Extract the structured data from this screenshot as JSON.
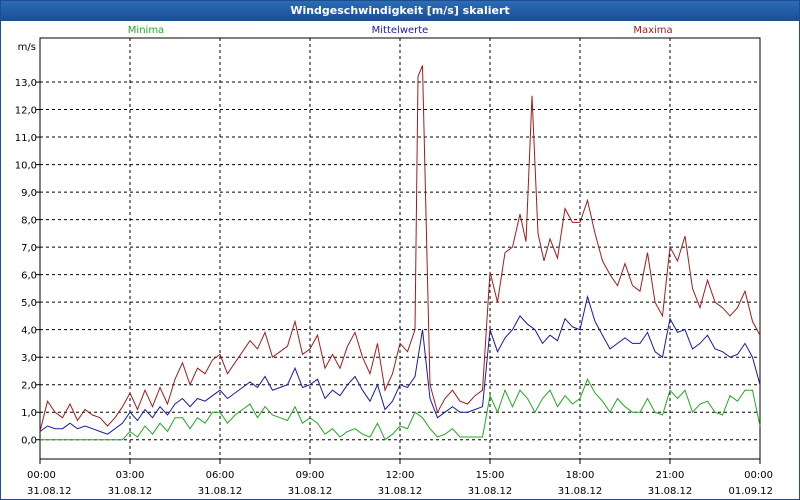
{
  "window": {
    "title": "Windgeschwindigkeit [m/s] skaliert"
  },
  "colors": {
    "titlebar": "#1f5aa6",
    "minima": "#22aa22",
    "mittel": "#1a1aa0",
    "maxima": "#a01c1c"
  },
  "legend": {
    "minima": "Minima",
    "mittel": "Mittelwerte",
    "maxima": "Maxima"
  },
  "chart_data": {
    "type": "line",
    "title": "Windgeschwindigkeit [m/s] skaliert",
    "ylabel": "m/s",
    "xlabel": "",
    "ylim": [
      -0.7,
      14.6
    ],
    "xlim_hours": [
      0,
      24
    ],
    "grid": true,
    "legend_placement": "top",
    "yticks": [
      "0,0",
      "1,0",
      "2,0",
      "3,0",
      "4,0",
      "5,0",
      "6,0",
      "7,0",
      "8,0",
      "9,0",
      "10,0",
      "11,0",
      "12,0",
      "13,0"
    ],
    "xticks": [
      {
        "time": "00:00",
        "date": "31.08.12"
      },
      {
        "time": "03:00",
        "date": "31.08.12"
      },
      {
        "time": "06:00",
        "date": "31.08.12"
      },
      {
        "time": "09:00",
        "date": "31.08.12"
      },
      {
        "time": "12:00",
        "date": "31.08.12"
      },
      {
        "time": "15:00",
        "date": "31.08.12"
      },
      {
        "time": "18:00",
        "date": "31.08.12"
      },
      {
        "time": "21:00",
        "date": "31.08.12"
      },
      {
        "time": "00:00",
        "date": "01.09.12"
      }
    ],
    "series": [
      {
        "name": "Maxima",
        "color": "#a01c1c",
        "points": [
          [
            0,
            0.3
          ],
          [
            0.25,
            1.4
          ],
          [
            0.5,
            1.0
          ],
          [
            0.75,
            0.8
          ],
          [
            1,
            1.3
          ],
          [
            1.25,
            0.7
          ],
          [
            1.5,
            1.1
          ],
          [
            1.75,
            0.9
          ],
          [
            2,
            0.8
          ],
          [
            2.25,
            0.5
          ],
          [
            2.5,
            0.8
          ],
          [
            2.75,
            1.2
          ],
          [
            3,
            1.7
          ],
          [
            3.25,
            1.1
          ],
          [
            3.5,
            1.8
          ],
          [
            3.75,
            1.2
          ],
          [
            4,
            1.9
          ],
          [
            4.25,
            1.3
          ],
          [
            4.5,
            2.2
          ],
          [
            4.75,
            2.8
          ],
          [
            5,
            2.0
          ],
          [
            5.25,
            2.6
          ],
          [
            5.5,
            2.4
          ],
          [
            5.75,
            2.9
          ],
          [
            6,
            3.1
          ],
          [
            6.25,
            2.4
          ],
          [
            6.5,
            2.8
          ],
          [
            6.75,
            3.2
          ],
          [
            7,
            3.6
          ],
          [
            7.25,
            3.3
          ],
          [
            7.5,
            3.9
          ],
          [
            7.75,
            3.0
          ],
          [
            8,
            3.2
          ],
          [
            8.25,
            3.4
          ],
          [
            8.5,
            4.3
          ],
          [
            8.75,
            3.1
          ],
          [
            9,
            3.3
          ],
          [
            9.25,
            3.8
          ],
          [
            9.5,
            2.6
          ],
          [
            9.75,
            3.1
          ],
          [
            10,
            2.6
          ],
          [
            10.25,
            3.4
          ],
          [
            10.5,
            3.9
          ],
          [
            10.75,
            3.0
          ],
          [
            11,
            2.4
          ],
          [
            11.25,
            3.5
          ],
          [
            11.5,
            1.8
          ],
          [
            11.75,
            2.4
          ],
          [
            12,
            3.5
          ],
          [
            12.25,
            3.2
          ],
          [
            12.5,
            4.0
          ],
          [
            12.6,
            13.2
          ],
          [
            12.75,
            13.6
          ],
          [
            13,
            2.0
          ],
          [
            13.25,
            1.0
          ],
          [
            13.5,
            1.5
          ],
          [
            13.75,
            1.8
          ],
          [
            14,
            1.4
          ],
          [
            14.25,
            1.3
          ],
          [
            14.5,
            1.6
          ],
          [
            14.75,
            1.8
          ],
          [
            15,
            6.1
          ],
          [
            15.25,
            5.0
          ],
          [
            15.5,
            6.8
          ],
          [
            15.75,
            7.0
          ],
          [
            16,
            8.2
          ],
          [
            16.2,
            7.2
          ],
          [
            16.4,
            12.5
          ],
          [
            16.6,
            7.5
          ],
          [
            16.8,
            6.5
          ],
          [
            17,
            7.3
          ],
          [
            17.25,
            6.6
          ],
          [
            17.5,
            8.4
          ],
          [
            17.75,
            7.9
          ],
          [
            18,
            7.9
          ],
          [
            18.25,
            8.7
          ],
          [
            18.5,
            7.5
          ],
          [
            18.75,
            6.5
          ],
          [
            19,
            6.0
          ],
          [
            19.25,
            5.6
          ],
          [
            19.5,
            6.4
          ],
          [
            19.75,
            5.6
          ],
          [
            20,
            5.4
          ],
          [
            20.25,
            6.8
          ],
          [
            20.5,
            5.0
          ],
          [
            20.75,
            4.5
          ],
          [
            21,
            7.0
          ],
          [
            21.25,
            6.5
          ],
          [
            21.5,
            7.4
          ],
          [
            21.75,
            5.5
          ],
          [
            22,
            4.8
          ],
          [
            22.25,
            5.8
          ],
          [
            22.5,
            5.0
          ],
          [
            22.75,
            4.8
          ],
          [
            23,
            4.5
          ],
          [
            23.25,
            4.8
          ],
          [
            23.5,
            5.4
          ],
          [
            23.75,
            4.3
          ],
          [
            24,
            3.8
          ]
        ]
      },
      {
        "name": "Mittelwerte",
        "color": "#1a1aa0",
        "points": [
          [
            0,
            0.3
          ],
          [
            0.25,
            0.5
          ],
          [
            0.5,
            0.4
          ],
          [
            0.75,
            0.4
          ],
          [
            1,
            0.6
          ],
          [
            1.25,
            0.4
          ],
          [
            1.5,
            0.5
          ],
          [
            1.75,
            0.4
          ],
          [
            2,
            0.3
          ],
          [
            2.25,
            0.2
          ],
          [
            2.5,
            0.4
          ],
          [
            2.75,
            0.6
          ],
          [
            3,
            1.0
          ],
          [
            3.25,
            0.7
          ],
          [
            3.5,
            1.1
          ],
          [
            3.75,
            0.8
          ],
          [
            4,
            1.2
          ],
          [
            4.25,
            0.9
          ],
          [
            4.5,
            1.3
          ],
          [
            4.75,
            1.5
          ],
          [
            5,
            1.2
          ],
          [
            5.25,
            1.5
          ],
          [
            5.5,
            1.4
          ],
          [
            5.75,
            1.6
          ],
          [
            6,
            1.8
          ],
          [
            6.25,
            1.5
          ],
          [
            6.5,
            1.7
          ],
          [
            6.75,
            1.9
          ],
          [
            7,
            2.1
          ],
          [
            7.25,
            1.9
          ],
          [
            7.5,
            2.3
          ],
          [
            7.75,
            1.8
          ],
          [
            8,
            1.9
          ],
          [
            8.25,
            2.0
          ],
          [
            8.5,
            2.6
          ],
          [
            8.75,
            1.9
          ],
          [
            9,
            2.0
          ],
          [
            9.25,
            2.2
          ],
          [
            9.5,
            1.5
          ],
          [
            9.75,
            1.8
          ],
          [
            10,
            1.6
          ],
          [
            10.25,
            2.0
          ],
          [
            10.5,
            2.3
          ],
          [
            10.75,
            1.8
          ],
          [
            11,
            1.4
          ],
          [
            11.25,
            2.0
          ],
          [
            11.5,
            1.1
          ],
          [
            11.75,
            1.4
          ],
          [
            12,
            2.0
          ],
          [
            12.25,
            1.9
          ],
          [
            12.5,
            2.3
          ],
          [
            12.75,
            4.0
          ],
          [
            13,
            1.5
          ],
          [
            13.25,
            0.8
          ],
          [
            13.5,
            1.0
          ],
          [
            13.75,
            1.2
          ],
          [
            14,
            1.0
          ],
          [
            14.25,
            1.0
          ],
          [
            14.5,
            1.1
          ],
          [
            14.75,
            1.2
          ],
          [
            15,
            4.0
          ],
          [
            15.25,
            3.2
          ],
          [
            15.5,
            3.7
          ],
          [
            15.75,
            4.0
          ],
          [
            16,
            4.5
          ],
          [
            16.25,
            4.2
          ],
          [
            16.5,
            4.0
          ],
          [
            16.75,
            3.5
          ],
          [
            17,
            3.8
          ],
          [
            17.25,
            3.6
          ],
          [
            17.5,
            4.4
          ],
          [
            17.75,
            4.1
          ],
          [
            18,
            4.0
          ],
          [
            18.25,
            5.2
          ],
          [
            18.5,
            4.3
          ],
          [
            18.75,
            3.8
          ],
          [
            19,
            3.3
          ],
          [
            19.25,
            3.5
          ],
          [
            19.5,
            3.7
          ],
          [
            19.75,
            3.5
          ],
          [
            20,
            3.5
          ],
          [
            20.25,
            3.9
          ],
          [
            20.5,
            3.2
          ],
          [
            20.75,
            3.0
          ],
          [
            21,
            4.4
          ],
          [
            21.25,
            3.9
          ],
          [
            21.5,
            4.0
          ],
          [
            21.75,
            3.3
          ],
          [
            22,
            3.5
          ],
          [
            22.25,
            3.8
          ],
          [
            22.5,
            3.3
          ],
          [
            22.75,
            3.2
          ],
          [
            23,
            3.0
          ],
          [
            23.25,
            3.1
          ],
          [
            23.5,
            3.5
          ],
          [
            23.75,
            3.0
          ],
          [
            24,
            2.0
          ]
        ]
      },
      {
        "name": "Minima",
        "color": "#22aa22",
        "points": [
          [
            0,
            0.0
          ],
          [
            0.5,
            0.0
          ],
          [
            1,
            0.0
          ],
          [
            1.5,
            0.0
          ],
          [
            2,
            0.0
          ],
          [
            2.5,
            0.0
          ],
          [
            2.75,
            0.0
          ],
          [
            3,
            0.3
          ],
          [
            3.25,
            0.1
          ],
          [
            3.5,
            0.5
          ],
          [
            3.75,
            0.2
          ],
          [
            4,
            0.6
          ],
          [
            4.25,
            0.3
          ],
          [
            4.5,
            0.8
          ],
          [
            4.75,
            0.8
          ],
          [
            5,
            0.4
          ],
          [
            5.25,
            0.8
          ],
          [
            5.5,
            0.6
          ],
          [
            5.75,
            1.0
          ],
          [
            6,
            1.0
          ],
          [
            6.25,
            0.6
          ],
          [
            6.5,
            0.9
          ],
          [
            6.75,
            1.1
          ],
          [
            7,
            1.3
          ],
          [
            7.25,
            0.8
          ],
          [
            7.5,
            1.2
          ],
          [
            7.75,
            0.9
          ],
          [
            8,
            0.8
          ],
          [
            8.25,
            0.7
          ],
          [
            8.5,
            1.2
          ],
          [
            8.75,
            0.6
          ],
          [
            9,
            0.8
          ],
          [
            9.25,
            0.6
          ],
          [
            9.5,
            0.2
          ],
          [
            9.75,
            0.4
          ],
          [
            10,
            0.1
          ],
          [
            10.25,
            0.3
          ],
          [
            10.5,
            0.4
          ],
          [
            10.75,
            0.2
          ],
          [
            11,
            0.1
          ],
          [
            11.25,
            0.6
          ],
          [
            11.5,
            0.0
          ],
          [
            11.75,
            0.2
          ],
          [
            12,
            0.5
          ],
          [
            12.25,
            0.4
          ],
          [
            12.5,
            1.0
          ],
          [
            12.75,
            0.8
          ],
          [
            13,
            0.4
          ],
          [
            13.25,
            0.1
          ],
          [
            13.5,
            0.2
          ],
          [
            13.75,
            0.4
          ],
          [
            14,
            0.1
          ],
          [
            14.25,
            0.1
          ],
          [
            14.5,
            0.1
          ],
          [
            14.75,
            0.1
          ],
          [
            15,
            1.6
          ],
          [
            15.25,
            1.0
          ],
          [
            15.5,
            1.8
          ],
          [
            15.75,
            1.2
          ],
          [
            16,
            1.8
          ],
          [
            16.25,
            1.5
          ],
          [
            16.5,
            1.0
          ],
          [
            16.75,
            1.5
          ],
          [
            17,
            1.8
          ],
          [
            17.25,
            1.2
          ],
          [
            17.5,
            1.6
          ],
          [
            17.75,
            1.3
          ],
          [
            18,
            1.5
          ],
          [
            18.25,
            2.2
          ],
          [
            18.5,
            1.7
          ],
          [
            18.75,
            1.4
          ],
          [
            19,
            1.0
          ],
          [
            19.25,
            1.5
          ],
          [
            19.5,
            1.2
          ],
          [
            19.75,
            1.0
          ],
          [
            20,
            1.0
          ],
          [
            20.25,
            1.5
          ],
          [
            20.5,
            1.0
          ],
          [
            20.75,
            0.9
          ],
          [
            21,
            1.8
          ],
          [
            21.25,
            1.5
          ],
          [
            21.5,
            1.8
          ],
          [
            21.75,
            1.0
          ],
          [
            22,
            1.3
          ],
          [
            22.25,
            1.4
          ],
          [
            22.5,
            1.0
          ],
          [
            22.75,
            0.9
          ],
          [
            23,
            1.6
          ],
          [
            23.25,
            1.4
          ],
          [
            23.5,
            1.8
          ],
          [
            23.75,
            1.8
          ],
          [
            24,
            0.5
          ]
        ]
      }
    ]
  }
}
